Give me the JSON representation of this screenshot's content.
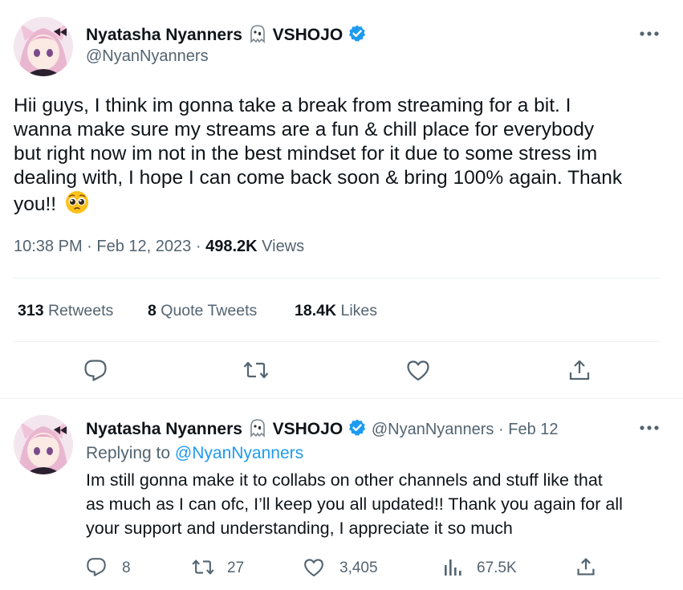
{
  "main_tweet": {
    "display_name": "Nyatasha Nyanners",
    "affiliation": "VSHOJO",
    "handle": "@NyanNyanners",
    "text_lines": [
      "Hii guys, I think im gonna take a break from streaming for a bit. I",
      "wanna make sure my streams are a fun & chill place for everybody",
      "but right now im not in the best mindset for it due to some stress im",
      "dealing with, I hope I can come back soon & bring 100% again. Thank",
      "you!!"
    ],
    "time": "10:38 PM",
    "date": "Feb 12, 2023",
    "separator": "·",
    "views_count": "498.2K",
    "views_label": "Views",
    "retweets_count": "313",
    "retweets_label": "Retweets",
    "quotes_count": "8",
    "quotes_label": "Quote Tweets",
    "likes_count": "18.4K",
    "likes_label": "Likes"
  },
  "reply_tweet": {
    "display_name": "Nyatasha Nyanners",
    "affiliation": "VSHOJO",
    "handle": "@NyanNyanners",
    "separator": "·",
    "date": "Feb 12",
    "replying_label": "Replying to",
    "replying_handle": "@NyanNyanners",
    "text_lines": [
      "Im still gonna make it to collabs on other channels and stuff like that",
      "as much as I can ofc, I’ll keep you all updated!! Thank you again for all",
      "your support and understanding, I appreciate it so much"
    ],
    "replies": "8",
    "retweets": "27",
    "likes": "3,405",
    "views": "67.5K"
  },
  "colors": {
    "text": "#0f1419",
    "secondary": "#536471",
    "verified": "#1d9bf0",
    "link": "#1d9bf0"
  },
  "icons": [
    "ghost-icon",
    "verified-badge-icon",
    "more-icon",
    "reply-icon",
    "retweet-icon",
    "like-icon",
    "share-icon",
    "views-icon",
    "pleading-face-emoji"
  ]
}
